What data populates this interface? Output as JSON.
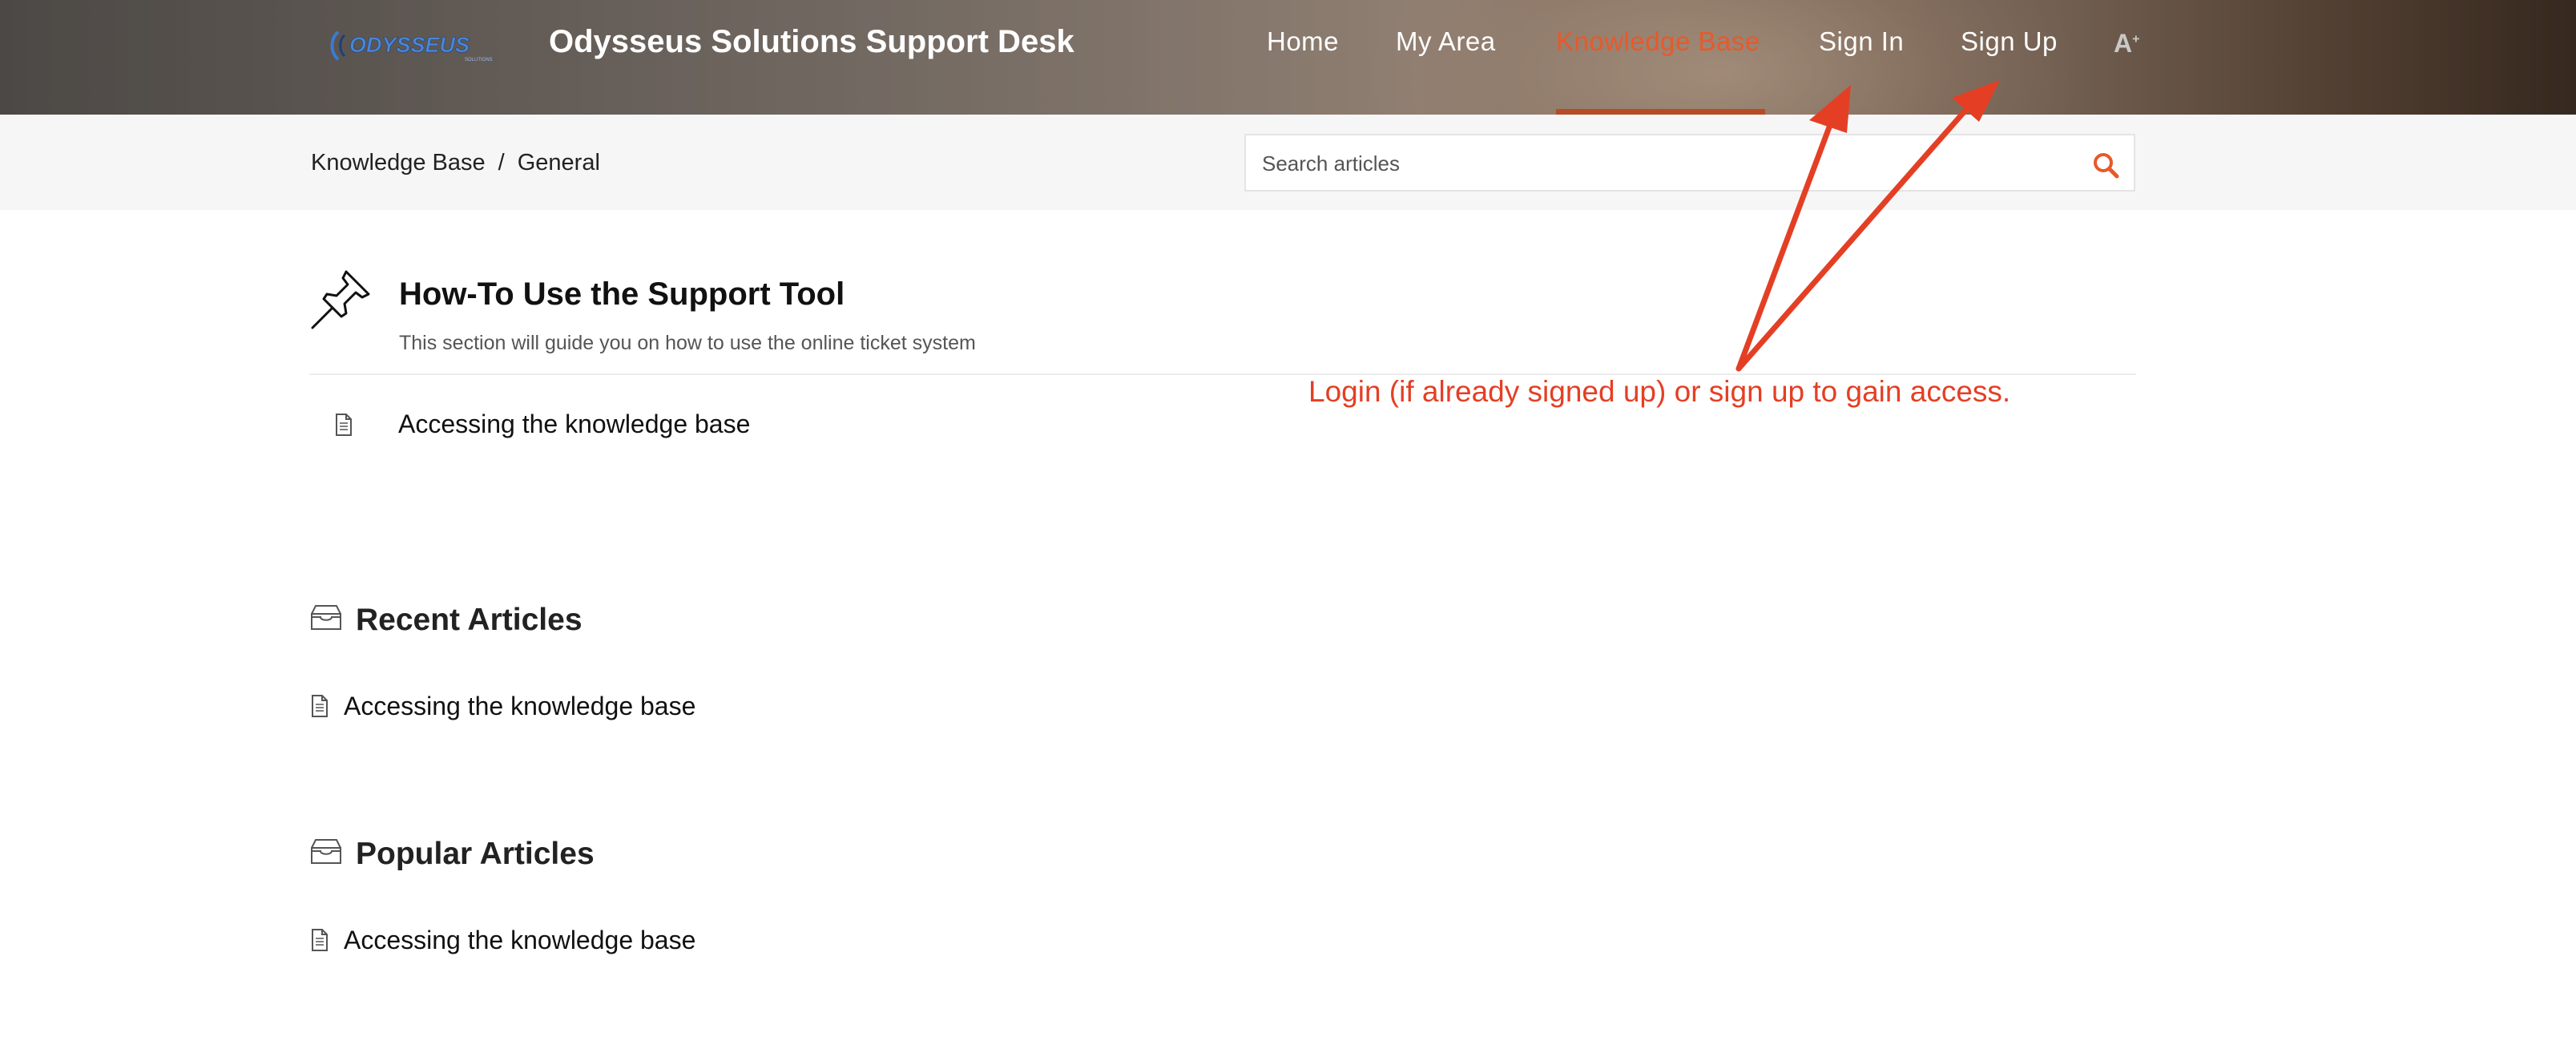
{
  "header": {
    "logo_text": "ODYSSEUS",
    "logo_subtext": "SOLUTIONS",
    "site_title": "Odysseus Solutions Support Desk",
    "nav": {
      "home": "Home",
      "my_area": "My Area",
      "knowledge_base": "Knowledge Base",
      "sign_in": "Sign In",
      "sign_up": "Sign Up"
    },
    "active_nav": "knowledge_base",
    "accessibility_icon": "font-size-icon"
  },
  "breadcrumb": {
    "root": "Knowledge Base",
    "separator": "/",
    "current": "General"
  },
  "search": {
    "placeholder": "Search articles",
    "value": ""
  },
  "section": {
    "icon": "pushpin-icon",
    "title": "How-To Use the Support Tool",
    "description": "This section will guide you on how to use the online ticket system",
    "articles": [
      "Accessing the knowledge base"
    ]
  },
  "recent": {
    "icon": "tray-icon",
    "title": "Recent Articles",
    "articles": [
      "Accessing the knowledge base"
    ]
  },
  "popular": {
    "icon": "tray-icon",
    "title": "Popular Articles",
    "articles": [
      "Accessing the knowledge base"
    ]
  },
  "annotation": {
    "text": "Login (if already signed up) or sign up to gain access.",
    "color": "#e43f24"
  },
  "colors": {
    "accent": "#e8592a",
    "header_text": "#ffffff"
  }
}
